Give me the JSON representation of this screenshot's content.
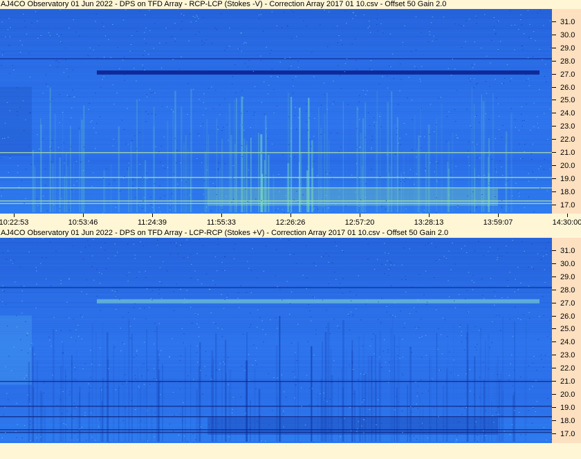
{
  "panels": [
    {
      "title": "AJ4CO Observatory 01 Jun 2022  -  DPS on TFD Array  -  RCP-LCP (Stokes -V)  -  Correction Array 2017 01 10.csv  -  Offset 50  Gain 2.0",
      "polarity": "positive"
    },
    {
      "title": "AJ4CO Observatory 01 Jun 2022  -  DPS on TFD Array  -  LCP-RCP (Stokes +V)  -  Correction Array 2017 01 10.csv  -  Offset 50  Gain 2.0",
      "polarity": "negative"
    }
  ],
  "x_ticks": [
    "10:22:53",
    "10:53:46",
    "11:24:39",
    "11:55:33",
    "12:26:26",
    "12:57:20",
    "13:28:13",
    "13:59:07",
    "14:30:00"
  ],
  "y_ticks": [
    "31.0",
    "30.0",
    "29.0",
    "28.0",
    "27.0",
    "26.0",
    "25.0",
    "24.0",
    "23.0",
    "22.0",
    "21.0",
    "20.0",
    "19.0",
    "18.0",
    "17.0"
  ],
  "colors": {
    "background_blue": "#2a6de6",
    "dark_band": "#0a1f8a",
    "bright_emission": "#9af0a0",
    "axis_panel": "#fde0c0",
    "page_bg": "#fff6d6"
  },
  "chart_data": [
    {
      "type": "heatmap",
      "title": "AJ4CO Observatory 01 Jun 2022  -  DPS on TFD Array  -  RCP-LCP (Stokes -V)  -  Correction Array 2017 01 10.csv  -  Offset 50  Gain 2.0",
      "x_ticks": [
        "10:22:53",
        "10:53:46",
        "11:24:39",
        "11:55:33",
        "12:26:26",
        "12:57:20",
        "13:28:13",
        "13:59:07",
        "14:30:00"
      ],
      "y_ticks": [
        31.0,
        30.0,
        29.0,
        28.0,
        27.0,
        26.0,
        25.0,
        24.0,
        23.0,
        22.0,
        21.0,
        20.0,
        19.0,
        18.0,
        17.0
      ],
      "ylim": [
        16.5,
        32.0
      ],
      "xlim": [
        "10:22:53",
        "14:30:00"
      ]
    },
    {
      "type": "heatmap",
      "title": "AJ4CO Observatory 01 Jun 2022  -  DPS on TFD Array  -  LCP-RCP (Stokes +V)  -  Correction Array 2017 01 10.csv  -  Offset 50  Gain 2.0",
      "x_ticks": [
        "10:22:53",
        "10:53:46",
        "11:24:39",
        "11:55:33",
        "12:26:26",
        "12:57:20",
        "13:28:13",
        "13:59:07",
        "14:30:00"
      ],
      "y_ticks": [
        31.0,
        30.0,
        29.0,
        28.0,
        27.0,
        26.0,
        25.0,
        24.0,
        23.0,
        22.0,
        21.0,
        20.0,
        19.0,
        18.0,
        17.0
      ],
      "ylim": [
        16.5,
        32.0
      ],
      "xlim": [
        "10:22:53",
        "14:30:00"
      ]
    }
  ]
}
